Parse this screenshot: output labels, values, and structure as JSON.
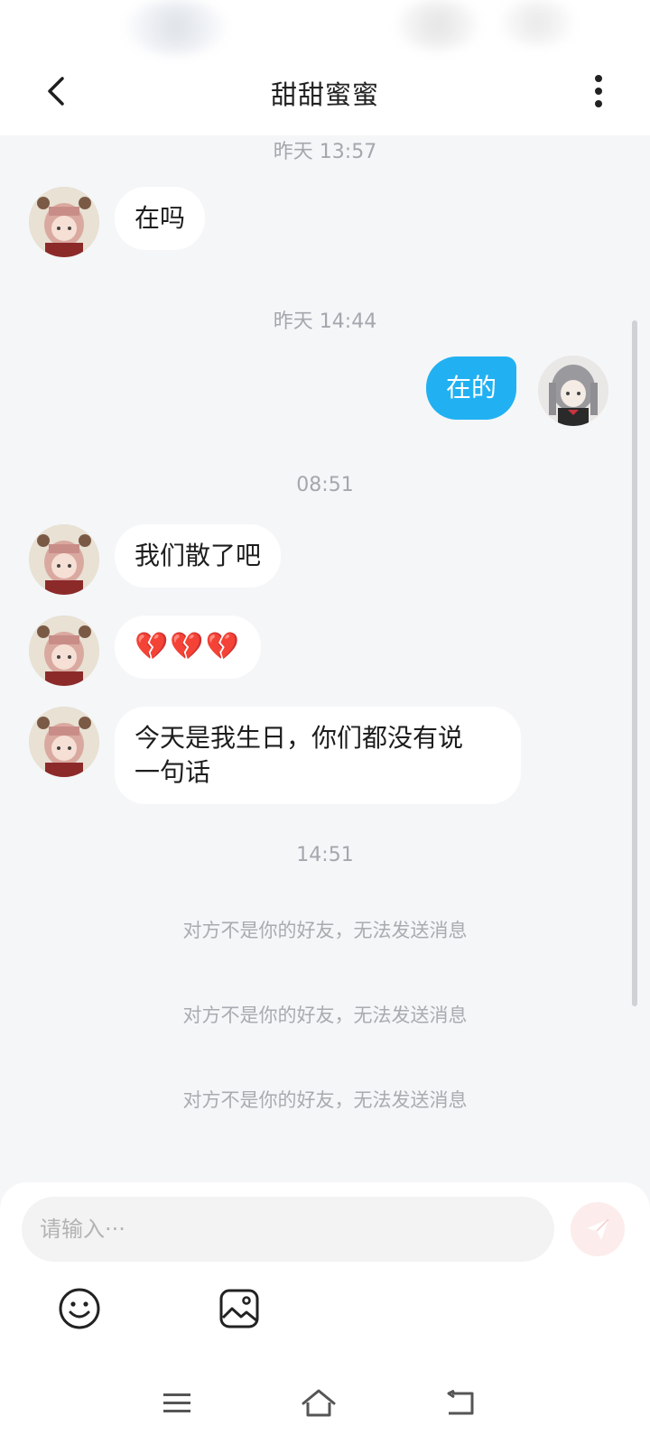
{
  "header": {
    "title": "甜甜蜜蜜"
  },
  "messages": {
    "ts1": "昨天 13:57",
    "m1": "在吗",
    "ts2": "昨天 14:44",
    "m2": "在的",
    "ts3": "08:51",
    "m3": "我们散了吧",
    "m4": "💔💔💔",
    "m5_line1": "今天是我生日，你们都没有说",
    "m5_line2": "一句话",
    "ts4": "14:51",
    "sys1": "对方不是你的好友，无法发送消息",
    "sys2": "对方不是你的好友，无法发送消息",
    "sys3": "对方不是你的好友，无法发送消息"
  },
  "composer": {
    "placeholder": "请输入···"
  },
  "colors": {
    "outgoing_bubble": "#21b1f2",
    "incoming_bubble": "#ffffff",
    "background": "#f5f6f8",
    "send_button": "#fdecec"
  },
  "icons": {
    "back": "chevron-left-icon",
    "more": "more-vertical-icon",
    "send": "paper-plane-icon",
    "emoji": "smiley-icon",
    "image": "image-icon",
    "nav_menu": "menu-icon",
    "nav_home": "home-icon",
    "nav_back": "return-icon"
  }
}
